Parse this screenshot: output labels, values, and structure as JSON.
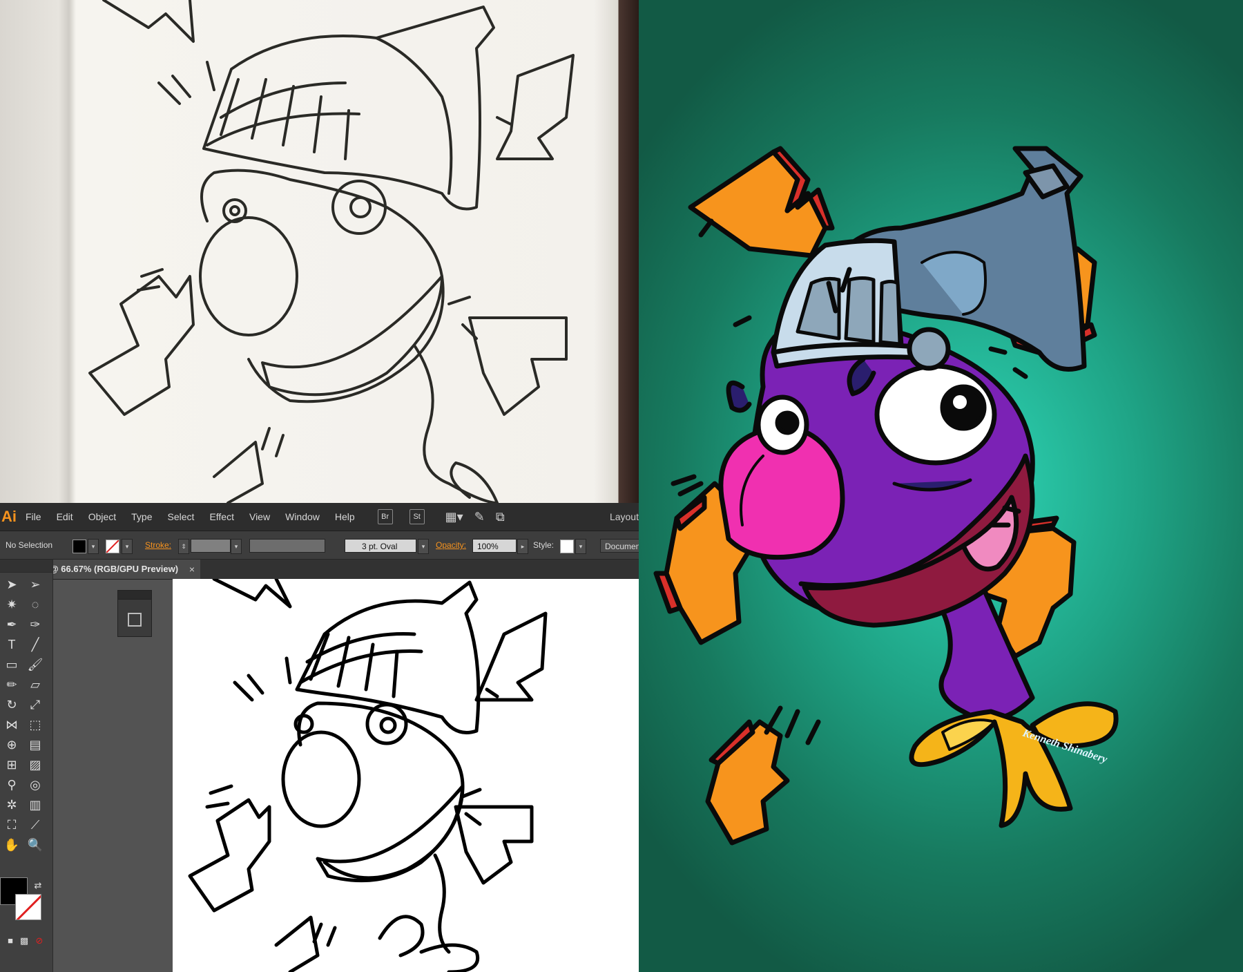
{
  "app": {
    "logo": "Ai",
    "menu": [
      "File",
      "Edit",
      "Object",
      "Type",
      "Select",
      "Effect",
      "View",
      "Window",
      "Help"
    ],
    "menu_icons": [
      "Br",
      "St"
    ],
    "workspace": "Layout"
  },
  "control_bar": {
    "selection": "No Selection",
    "stroke_label": "Stroke:",
    "brush": "3 pt. Oval",
    "opacity_label": "Opacity:",
    "opacity_value": "100%",
    "style_label": "Style:",
    "document_button": "Documen"
  },
  "document_tab": {
    "title": "@ 66.67% (RGB/GPU Preview)",
    "close": "×"
  },
  "toolbox": {
    "tools": [
      "selection",
      "direct-selection",
      "magic-wand",
      "lasso",
      "pen",
      "curvature",
      "type",
      "line",
      "rectangle",
      "paintbrush",
      "pencil",
      "eraser",
      "rotate",
      "scale",
      "width",
      "free-transform",
      "shape-builder",
      "perspective",
      "mesh",
      "gradient",
      "eyedropper",
      "blend",
      "symbol-sprayer",
      "column-graph",
      "artboard",
      "slice",
      "hand",
      "zoom"
    ]
  },
  "colors": {
    "accent": "#f7931e",
    "fill": "#000000",
    "stroke_none": "#e02020",
    "background_teal": "#1fa486",
    "character_purple": "#7b22b5",
    "nose_pink": "#f030b0",
    "bolt_orange": "#f7941d",
    "bolt_red": "#d9302a",
    "helmet_blue": "#5f7f9c",
    "ribbon_yellow": "#f5b419"
  },
  "artwork": {
    "signature": "Kenneth Shinabery"
  }
}
